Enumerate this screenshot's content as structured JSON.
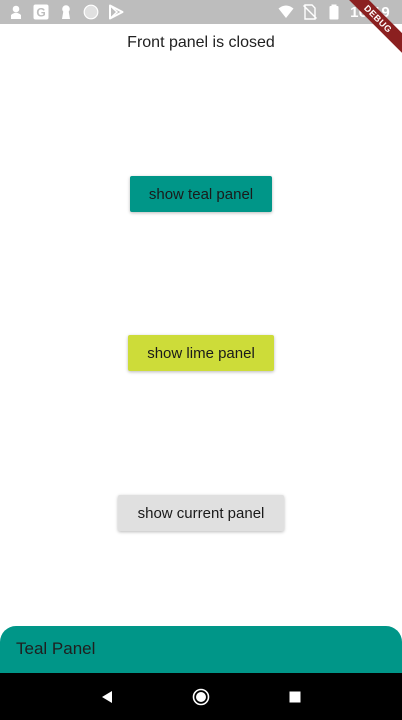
{
  "status_bar": {
    "time": "16:19",
    "left_icons": [
      "person-icon",
      "google-icon",
      "keyhole-icon",
      "circle-icon",
      "play-store-icon"
    ],
    "right_icons": [
      "wifi-icon",
      "no-sim-icon",
      "battery-icon"
    ]
  },
  "debug_banner": {
    "label": "DEBUG"
  },
  "header": {
    "status_text": "Front panel is closed"
  },
  "buttons": {
    "teal": {
      "label": "show teal panel",
      "color": "#009688"
    },
    "lime": {
      "label": "show lime panel",
      "color": "#cddc39"
    },
    "current": {
      "label": "show current panel",
      "color": "#e0e0e0"
    }
  },
  "panel": {
    "title": "Teal Panel",
    "color": "#009688"
  },
  "nav_bar": {
    "icons": [
      "back-icon",
      "home-icon",
      "recents-icon"
    ]
  }
}
